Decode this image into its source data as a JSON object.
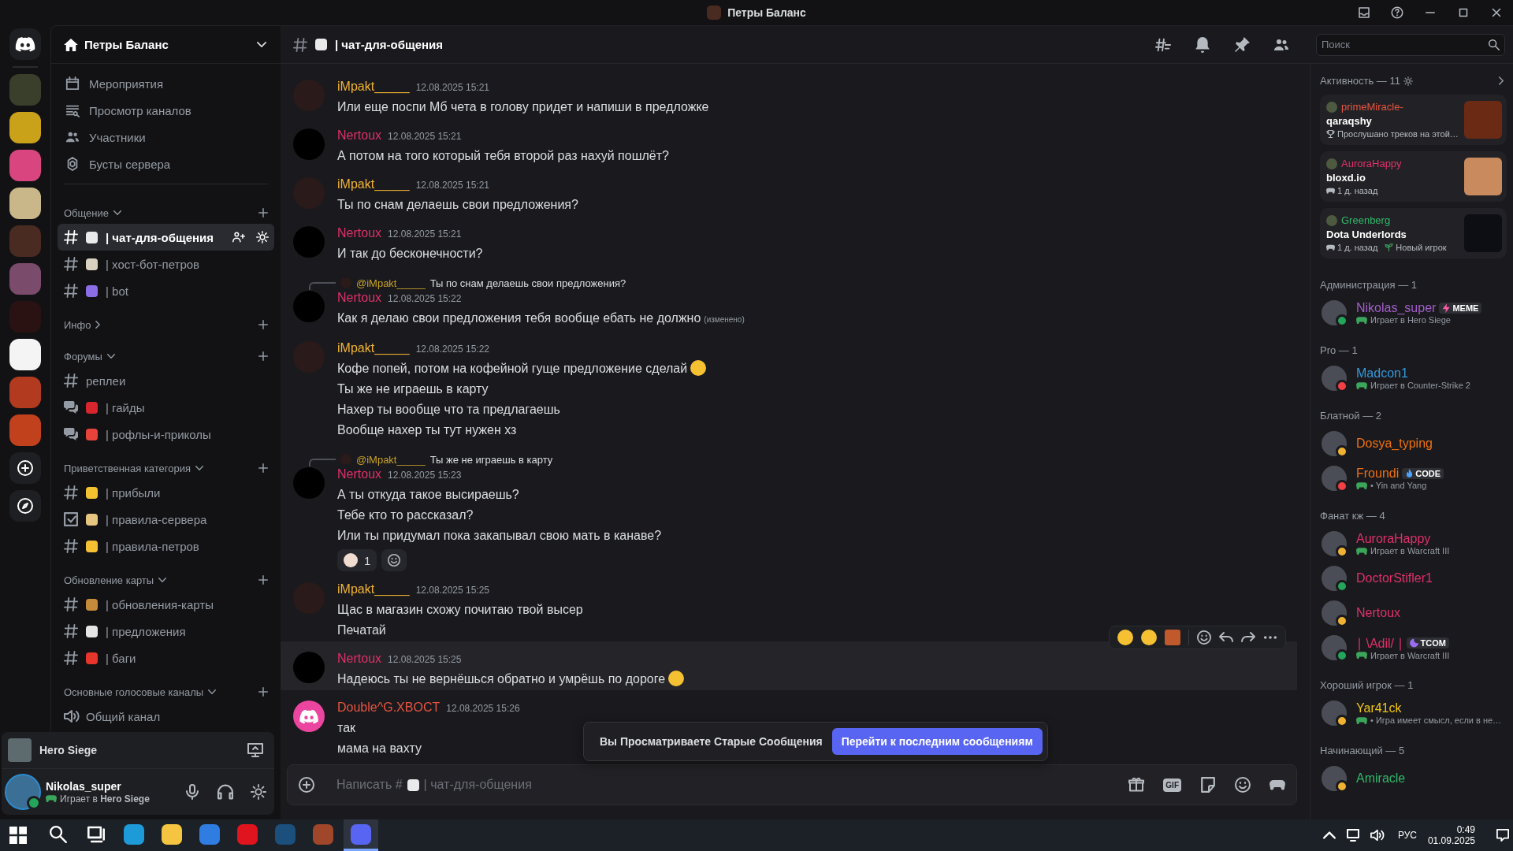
{
  "window": {
    "title": "Петры Баланс"
  },
  "server": {
    "name": "Петры Баланс"
  },
  "menu": [
    {
      "label": "Мероприятия",
      "kind": "events"
    },
    {
      "label": "Просмотр каналов",
      "kind": "browse"
    },
    {
      "label": "Участники",
      "kind": "members"
    },
    {
      "label": "Бусты сервера",
      "kind": "boost"
    }
  ],
  "categories": [
    {
      "name": "Общение",
      "expanded": true,
      "channels": [
        {
          "name": "| чат-для-общения",
          "kind": "text",
          "color": "#e9eaec",
          "selected": true
        },
        {
          "name": "| хост-бот-петров",
          "kind": "text",
          "color": "#d9d2c0",
          "selected": false
        },
        {
          "name": "| bot",
          "kind": "text",
          "color": "#8b6ee6",
          "selected": false
        }
      ]
    },
    {
      "name": "Инфо",
      "expanded": false
    },
    {
      "name": "Форумы",
      "expanded": true,
      "channels": [
        {
          "name": "реплеи",
          "kind": "text",
          "selected": false
        },
        {
          "name": "| гайды",
          "kind": "forum",
          "color": "#d8262f",
          "selected": false
        },
        {
          "name": "| рофлы-и-приколы",
          "kind": "forum",
          "color": "#e8433a",
          "selected": false
        }
      ]
    },
    {
      "name": "Приветственная категория",
      "expanded": true,
      "channels": [
        {
          "name": "| прибыли",
          "kind": "text",
          "color": "#f2c230",
          "selected": false
        },
        {
          "name": "| правила-сервера",
          "kind": "rules",
          "color": "#e7c680",
          "selected": false
        },
        {
          "name": "| правила-петров",
          "kind": "text",
          "color": "#f5c133",
          "selected": false
        }
      ]
    },
    {
      "name": "Обновление карты",
      "expanded": true,
      "channels": [
        {
          "name": "| обновления-карты",
          "kind": "text",
          "color": "#c58b3b",
          "selected": false
        },
        {
          "name": "| предложения",
          "kind": "text",
          "color": "#e5e5e5",
          "selected": false
        },
        {
          "name": "| баги",
          "kind": "text",
          "color": "#e6352b",
          "selected": false
        }
      ]
    },
    {
      "name": "Основные голосовые каналы",
      "expanded": true,
      "channels": [
        {
          "name": "Общий канал",
          "kind": "voice",
          "selected": false
        }
      ]
    }
  ],
  "now_playing": {
    "game": "Hero Siege"
  },
  "user": {
    "name": "Nikolas_super",
    "activity": "Играет в **Hero Siege**",
    "kind": "online"
  },
  "header": {
    "channel": "| чат-для-общения",
    "search_placeholder": "Поиск"
  },
  "messages": [
    {
      "author": "iMpakt_____",
      "color": "#f0b232",
      "kind": "impakt",
      "time": "12.08.2025 15:21",
      "hovered": false,
      "lines": [
        {
          "text": "Или еще поспи Мб чета в голову придет и напиши в предложке"
        }
      ]
    },
    {
      "author": "Nertoux",
      "color": "#e0306a",
      "kind": "nertoux",
      "time": "12.08.2025 15:21",
      "hovered": false,
      "lines": [
        {
          "text": "А потом на того который тебя второй раз нахуй пошлёт?"
        }
      ]
    },
    {
      "author": "iMpakt_____",
      "color": "#f0b232",
      "kind": "impakt",
      "time": "12.08.2025 15:21",
      "hovered": false,
      "lines": [
        {
          "text": "Ты по снам делаешь свои предложения?"
        }
      ]
    },
    {
      "author": "Nertoux",
      "color": "#e0306a",
      "kind": "nertoux",
      "time": "12.08.2025 15:21",
      "hovered": false,
      "lines": [
        {
          "text": "И так до бесконечности?"
        }
      ]
    },
    {
      "author": "Nertoux",
      "color": "#e0306a",
      "kind": "nertoux",
      "time": "12.08.2025 15:22",
      "hovered": false,
      "reply": {
        "mention": "@iMpakt_____",
        "text": "Ты по снам делаешь свои предложения?"
      },
      "lines": [
        {
          "text": "Как я делаю свои предложения тебя вообще ебать не должно",
          "edited": "(изменено)"
        }
      ]
    },
    {
      "author": "iMpakt_____",
      "color": "#f0b232",
      "kind": "impakt",
      "time": "12.08.2025 15:22",
      "hovered": false,
      "lines": [
        {
          "text": "Кофе попей, потом на кофейной гуще предложение сделай",
          "emoji": true
        },
        {
          "text": "Ты же не играешь в карту"
        },
        {
          "text": "Нахер ты вообще что та предлагаешь"
        },
        {
          "text": "Вообще нахер ты тут нужен хз"
        }
      ]
    },
    {
      "author": "Nertoux",
      "color": "#e0306a",
      "kind": "nertoux",
      "time": "12.08.2025 15:23",
      "hovered": false,
      "reply": {
        "mention": "@iMpakt_____",
        "text": "Ты же не играешь в карту"
      },
      "lines": [
        {
          "text": "А ты откуда такое высираешь?"
        },
        {
          "text": "Тебе кто то рассказал?"
        },
        {
          "text": "Или ты придумал пока закапывал свою мать в канаве?"
        }
      ],
      "reactions": [
        {
          "count": "1"
        }
      ]
    },
    {
      "author": "iMpakt_____",
      "color": "#f0b232",
      "kind": "impakt",
      "time": "12.08.2025 15:25",
      "hovered": false,
      "lines": [
        {
          "text": "Щас в магазин схожу почитаю твой высер"
        },
        {
          "text": "Печатай"
        }
      ]
    },
    {
      "author": "Nertoux",
      "color": "#e0306a",
      "kind": "nertoux",
      "time": "12.08.2025 15:25",
      "hovered": true,
      "lines": [
        {
          "text": "Надеюсь ты не вернёшься обратно и умрёшь по дороге",
          "emoji": true
        }
      ]
    },
    {
      "author": "Double^G.XBOCT",
      "color": "#e8543f",
      "kind": "discord",
      "time": "12.08.2025 15:26",
      "hovered": false,
      "lines": [
        {
          "text": "так"
        },
        {
          "text": "мама на вахту"
        }
      ]
    }
  ],
  "banner": {
    "text": "Вы Просматриваете Старые Сообщения",
    "button": "Перейти к последним сообщениям"
  },
  "composer": {
    "placeholder_start": "Написать #",
    "placeholder_end": "| чат-для-общения",
    "gif": "GIF"
  },
  "activity": {
    "title": "Активность — 11",
    "cards": [
      {
        "user": "primeMiracle-",
        "color": "#e8543f",
        "title": "qaraqshy",
        "kind": "album",
        "details": [
          {
            "kind": "trophy",
            "text": "Прослушано треков на этой…"
          }
        ]
      },
      {
        "user": "AuroraHappy",
        "color": "#e0306a",
        "title": "bloxd.io",
        "kind": "blocky",
        "details": [
          {
            "kind": "controller",
            "text": "1 д. назад"
          }
        ]
      },
      {
        "user": "Greenberg",
        "color": "#2fb86a",
        "title": "Dota Underlords",
        "kind": "logo",
        "details": [
          {
            "kind": "controller",
            "text": "1 д. назад"
          },
          {
            "kind": "sprout",
            "text": "Новый игрок"
          }
        ]
      }
    ]
  },
  "member_groups": [
    {
      "title": "Администрация — 1",
      "members": [
        {
          "name": "Nikolas_super",
          "color": "#a35ec9",
          "kind": "online",
          "activity": "Играет в Hero Siege",
          "badge": {
            "kind": "bolt",
            "text": "MEME"
          }
        }
      ]
    },
    {
      "title": "Pro — 1",
      "members": [
        {
          "name": "Madcon1",
          "color": "#3498db",
          "kind": "dnd",
          "activity": "Играет в Counter-Strike 2"
        }
      ]
    },
    {
      "title": "Блатной — 2",
      "members": [
        {
          "name": "Dosya_typing",
          "color": "#f0700f",
          "kind": "idle"
        },
        {
          "name": "Froundi",
          "color": "#f0700f",
          "kind": "dnd",
          "activity": "• Yin and Yang",
          "badge": {
            "kind": "flame",
            "text": "CODE"
          }
        }
      ]
    },
    {
      "title": "Фанат кж — 4",
      "members": [
        {
          "name": "AuroraHappy",
          "color": "#e0306a",
          "kind": "idle",
          "activity": "Играет в Warcraft III"
        },
        {
          "name": "DoctorStifler1",
          "color": "#e0306a",
          "kind": "online"
        },
        {
          "name": "Nertoux",
          "color": "#e0306a",
          "kind": "idle"
        },
        {
          "name": "∣ \\Adil/ ∣",
          "color": "#e0306a",
          "kind": "online",
          "activity": "Играет в Warcraft III",
          "badge": {
            "kind": "moon",
            "text": "TCOM"
          }
        }
      ]
    },
    {
      "title": "Хороший игрок — 1",
      "members": [
        {
          "name": "Yar41ck",
          "color": "#f0c419",
          "kind": "idle",
          "activity": "• Игра имеет смысл, если в не…"
        }
      ]
    },
    {
      "title": "Начинающий — 5",
      "members": [
        {
          "name": "Amiracle",
          "color": "#2fb86a",
          "kind": "idle"
        }
      ]
    }
  ],
  "taskbar": {
    "apps": [
      {
        "kind": "search",
        "selected": false
      },
      {
        "kind": "taskview",
        "selected": false
      },
      {
        "kind": "edge",
        "selected": false
      },
      {
        "kind": "explorer",
        "selected": false
      },
      {
        "kind": "store",
        "selected": false
      },
      {
        "kind": "opera",
        "selected": false
      },
      {
        "kind": "steam",
        "selected": false
      },
      {
        "kind": "game",
        "selected": false
      },
      {
        "kind": "discord",
        "selected": true
      }
    ],
    "lang": "РУС",
    "time": "0:49",
    "date": "01.09.2025"
  }
}
